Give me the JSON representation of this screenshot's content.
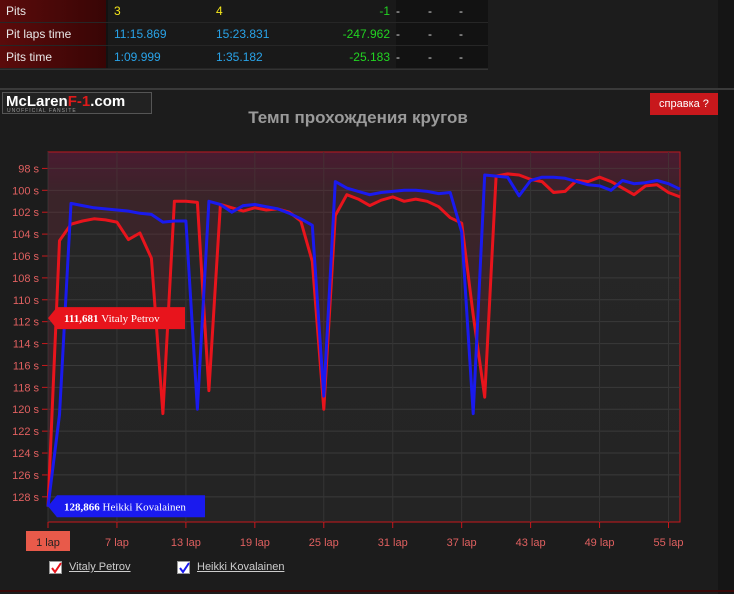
{
  "stats": {
    "rows": [
      {
        "label": "Pits",
        "v1": "3",
        "v2": "4",
        "diff": "-1",
        "d1": "-",
        "d2": "-",
        "d3": "-",
        "color1": "#f6e71a",
        "color2": "#f6e71a",
        "diffColor": "#22d422"
      },
      {
        "label": "Pit laps time",
        "v1": "11:15.869",
        "v2": "15:23.831",
        "diff": "-247.962",
        "d1": "-",
        "d2": "-",
        "d3": "-",
        "color1": "#29a3e8",
        "color2": "#29a3e8",
        "diffColor": "#22d422"
      },
      {
        "label": "Pits time",
        "v1": "1:09.999",
        "v2": "1:35.182",
        "diff": "-25.183",
        "d1": "-",
        "d2": "-",
        "d3": "-",
        "color1": "#29a3e8",
        "color2": "#29a3e8",
        "diffColor": "#22d422"
      }
    ]
  },
  "header": {
    "logo_text": "McLaren",
    "logo_accent": "F-1",
    "logo_suffix": ".com",
    "logo_tag": "UNOFFICIAL FANSITE",
    "help_label": "справка ?"
  },
  "chart_data": {
    "type": "line",
    "title": "Темп прохождения кругов",
    "y_tick_labels": [
      "98 s",
      "100 s",
      "102 s",
      "104 s",
      "106 s",
      "108 s",
      "110 s",
      "112 s",
      "114 s",
      "116 s",
      "118 s",
      "120 s",
      "122 s",
      "124 s",
      "126 s",
      "128 s"
    ],
    "y_ticks": [
      98,
      100,
      102,
      104,
      106,
      108,
      110,
      112,
      114,
      116,
      118,
      120,
      122,
      124,
      126,
      128
    ],
    "ylim": [
      96.5,
      130.3
    ],
    "y_inverted": true,
    "x_tick_labels": [
      "1 lap",
      "7 lap",
      "13 lap",
      "19 lap",
      "25 lap",
      "31 lap",
      "37 lap",
      "43 lap",
      "49 lap",
      "55 lap"
    ],
    "x_ticks": [
      1,
      7,
      13,
      19,
      25,
      31,
      37,
      43,
      49,
      55
    ],
    "xlim": [
      1,
      56
    ],
    "highlighted_x_tick": "1 lap",
    "series": [
      {
        "name": "Vitaly Petrov",
        "color": "#e8141c",
        "x": [
          1,
          2,
          3,
          4,
          5,
          6,
          7,
          8,
          9,
          10,
          11,
          12,
          13,
          14,
          15,
          16,
          17,
          18,
          19,
          20,
          21,
          22,
          23,
          24,
          25,
          26,
          27,
          28,
          29,
          30,
          31,
          32,
          33,
          34,
          35,
          36,
          37,
          38,
          39,
          40,
          41,
          42,
          43,
          44,
          45,
          46,
          47,
          48,
          49,
          50,
          51,
          52,
          53,
          54,
          55,
          56
        ],
        "values": [
          128.9,
          104.6,
          103.1,
          102.8,
          102.6,
          102.7,
          102.9,
          104.5,
          103.9,
          106.2,
          120.4,
          101.0,
          101.0,
          101.1,
          118.3,
          101.3,
          101.6,
          101.9,
          101.6,
          101.8,
          101.7,
          102.0,
          102.8,
          106.5,
          120.0,
          102.3,
          100.4,
          100.8,
          101.4,
          100.9,
          100.6,
          101.0,
          100.8,
          101.0,
          101.5,
          102.5,
          103.0,
          111.4,
          118.9,
          98.7,
          98.5,
          98.6,
          99.0,
          99.2,
          100.2,
          100.1,
          99.1,
          99.2,
          98.8,
          99.2,
          99.8,
          100.4,
          99.6,
          99.5,
          100.2,
          100.6
        ],
        "callout": "111,681",
        "callout_name": "Vitaly Petrov"
      },
      {
        "name": "Heikki Kovalainen",
        "color": "#1a1aee",
        "x": [
          1,
          2,
          3,
          4,
          5,
          6,
          7,
          8,
          9,
          10,
          11,
          12,
          13,
          14,
          15,
          16,
          17,
          18,
          19,
          20,
          21,
          22,
          23,
          24,
          25,
          26,
          27,
          28,
          29,
          30,
          31,
          32,
          33,
          34,
          35,
          36,
          37,
          38,
          39,
          40,
          41,
          42,
          43,
          44,
          45,
          46,
          47,
          48,
          49,
          50,
          51,
          52,
          53,
          54,
          55,
          56
        ],
        "values": [
          128.9,
          120.5,
          101.2,
          101.4,
          101.6,
          101.7,
          101.8,
          101.9,
          102.1,
          102.2,
          102.9,
          102.8,
          102.8,
          120.0,
          101.0,
          101.3,
          102.0,
          101.4,
          101.3,
          101.5,
          101.7,
          102.1,
          102.6,
          103.2,
          118.8,
          99.2,
          99.8,
          100.1,
          100.4,
          100.2,
          100.1,
          100.0,
          100.0,
          100.1,
          100.3,
          100.2,
          103.8,
          120.4,
          98.6,
          98.7,
          98.8,
          100.5,
          99.1,
          98.8,
          98.8,
          98.9,
          99.2,
          99.5,
          99.6,
          100.0,
          99.1,
          99.4,
          99.3,
          99.1,
          99.4,
          99.9
        ],
        "callout": "128,866",
        "callout_name": "Heikki Kovalainen"
      }
    ],
    "legend": [
      {
        "label": "Vitaly Petrov",
        "checked": true,
        "color": "#e8141c"
      },
      {
        "label": "Heikki Kovalainen",
        "checked": true,
        "color": "#1a1aee"
      }
    ],
    "grid": true
  }
}
